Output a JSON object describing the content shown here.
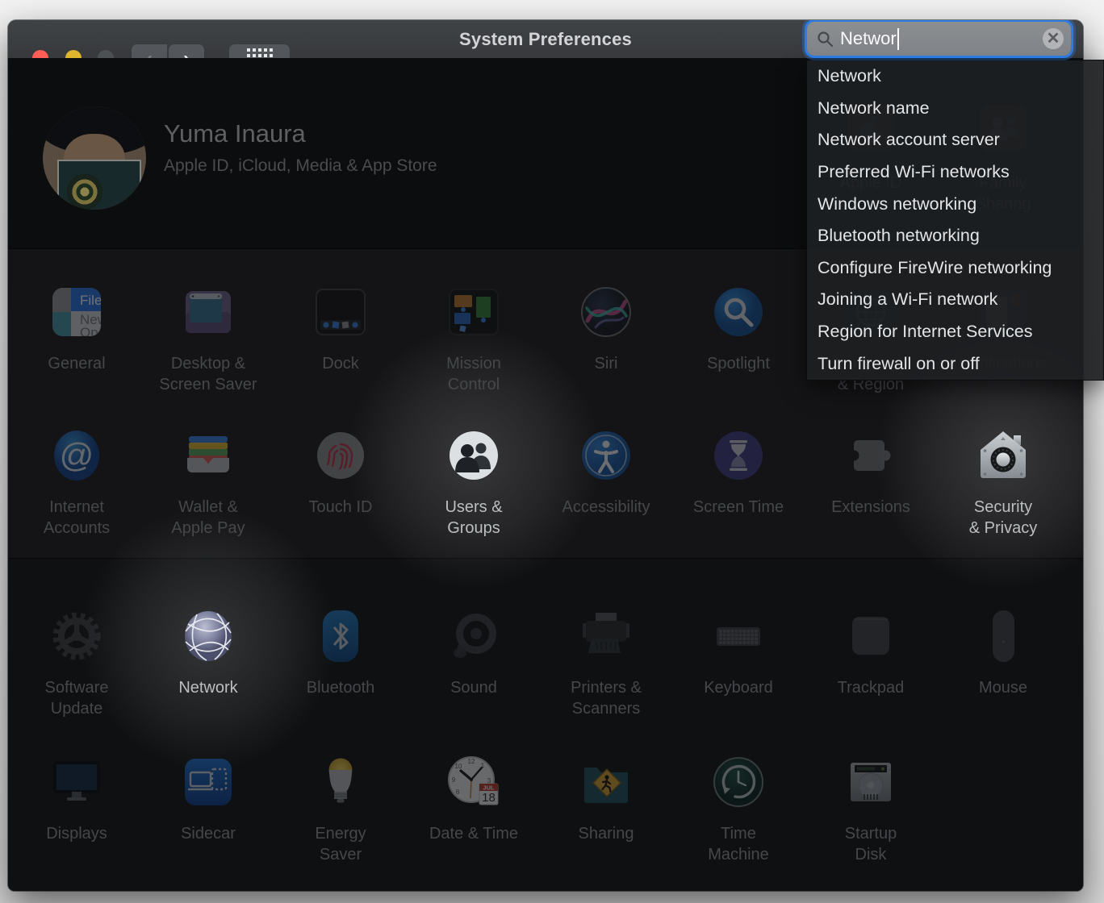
{
  "titlebar": {
    "title": "System Preferences",
    "back_glyph": "‹",
    "forward_glyph": "›"
  },
  "search": {
    "value": "Networ",
    "clear_glyph": "✕",
    "suggestions": [
      "Network",
      "Network name",
      "Network account server",
      "Preferred Wi-Fi networks",
      "Windows networking",
      "Bluetooth networking",
      "Configure FireWire networking",
      "Joining a Wi-Fi network",
      "Region for Internet Services",
      "Turn firewall on or off"
    ]
  },
  "user": {
    "name": "Yuma Inaura",
    "subtitle": "Apple ID, iCloud, Media & App Store"
  },
  "grid": {
    "account": [
      {
        "id": "apple-id",
        "label": "Apple ID",
        "col": 7,
        "highlighted": false
      },
      {
        "id": "family-sharing",
        "label": "Family\nSharing",
        "col": 8,
        "highlighted": false
      }
    ],
    "row1": [
      {
        "id": "general",
        "label": "General",
        "col": 1,
        "highlighted": false
      },
      {
        "id": "desktop",
        "label": "Desktop &\nScreen Saver",
        "col": 2,
        "highlighted": false
      },
      {
        "id": "dock",
        "label": "Dock",
        "col": 3,
        "highlighted": false
      },
      {
        "id": "mission-control",
        "label": "Mission\nControl",
        "col": 4,
        "highlighted": false
      },
      {
        "id": "siri",
        "label": "Siri",
        "col": 5,
        "highlighted": false
      },
      {
        "id": "spotlight",
        "label": "Spotlight",
        "col": 6,
        "highlighted": false
      },
      {
        "id": "language",
        "label": "Language\n& Region",
        "col": 7,
        "highlighted": false
      },
      {
        "id": "notifications",
        "label": "Notifications",
        "col": 8,
        "highlighted": false
      }
    ],
    "row2": [
      {
        "id": "internet-accounts",
        "label": "Internet\nAccounts",
        "col": 1,
        "highlighted": false
      },
      {
        "id": "wallet",
        "label": "Wallet &\nApple Pay",
        "col": 2,
        "highlighted": false
      },
      {
        "id": "touch-id",
        "label": "Touch ID",
        "col": 3,
        "highlighted": false
      },
      {
        "id": "users-groups",
        "label": "Users &\nGroups",
        "col": 4,
        "highlighted": true
      },
      {
        "id": "accessibility",
        "label": "Accessibility",
        "col": 5,
        "highlighted": false
      },
      {
        "id": "screen-time",
        "label": "Screen Time",
        "col": 6,
        "highlighted": false
      },
      {
        "id": "extensions",
        "label": "Extensions",
        "col": 7,
        "highlighted": false
      },
      {
        "id": "security",
        "label": "Security\n& Privacy",
        "col": 8,
        "highlighted": true
      }
    ],
    "row3": [
      {
        "id": "software-update",
        "label": "Software\nUpdate",
        "col": 1,
        "highlighted": false
      },
      {
        "id": "network",
        "label": "Network",
        "col": 2,
        "highlighted": true
      },
      {
        "id": "bluetooth",
        "label": "Bluetooth",
        "col": 3,
        "highlighted": false
      },
      {
        "id": "sound",
        "label": "Sound",
        "col": 4,
        "highlighted": false
      },
      {
        "id": "printers",
        "label": "Printers &\nScanners",
        "col": 5,
        "highlighted": false
      },
      {
        "id": "keyboard",
        "label": "Keyboard",
        "col": 6,
        "highlighted": false
      },
      {
        "id": "trackpad",
        "label": "Trackpad",
        "col": 7,
        "highlighted": false
      },
      {
        "id": "mouse",
        "label": "Mouse",
        "col": 8,
        "highlighted": false
      }
    ],
    "row4": [
      {
        "id": "displays",
        "label": "Displays",
        "col": 1,
        "highlighted": false
      },
      {
        "id": "sidecar",
        "label": "Sidecar",
        "col": 2,
        "highlighted": false
      },
      {
        "id": "energy-saver",
        "label": "Energy\nSaver",
        "col": 3,
        "highlighted": false
      },
      {
        "id": "date-time",
        "label": "Date & Time",
        "col": 4,
        "highlighted": false
      },
      {
        "id": "sharing",
        "label": "Sharing",
        "col": 5,
        "highlighted": false
      },
      {
        "id": "time-machine",
        "label": "Time\nMachine",
        "col": 6,
        "highlighted": false
      },
      {
        "id": "startup-disk",
        "label": "Startup\nDisk",
        "col": 7,
        "highlighted": false
      }
    ]
  },
  "colors": {
    "accent_blue": "#2e7ce2",
    "dim_label": "#45474a",
    "highlight_label": "#bcbec0",
    "panel_bg": "#1d1f22"
  }
}
